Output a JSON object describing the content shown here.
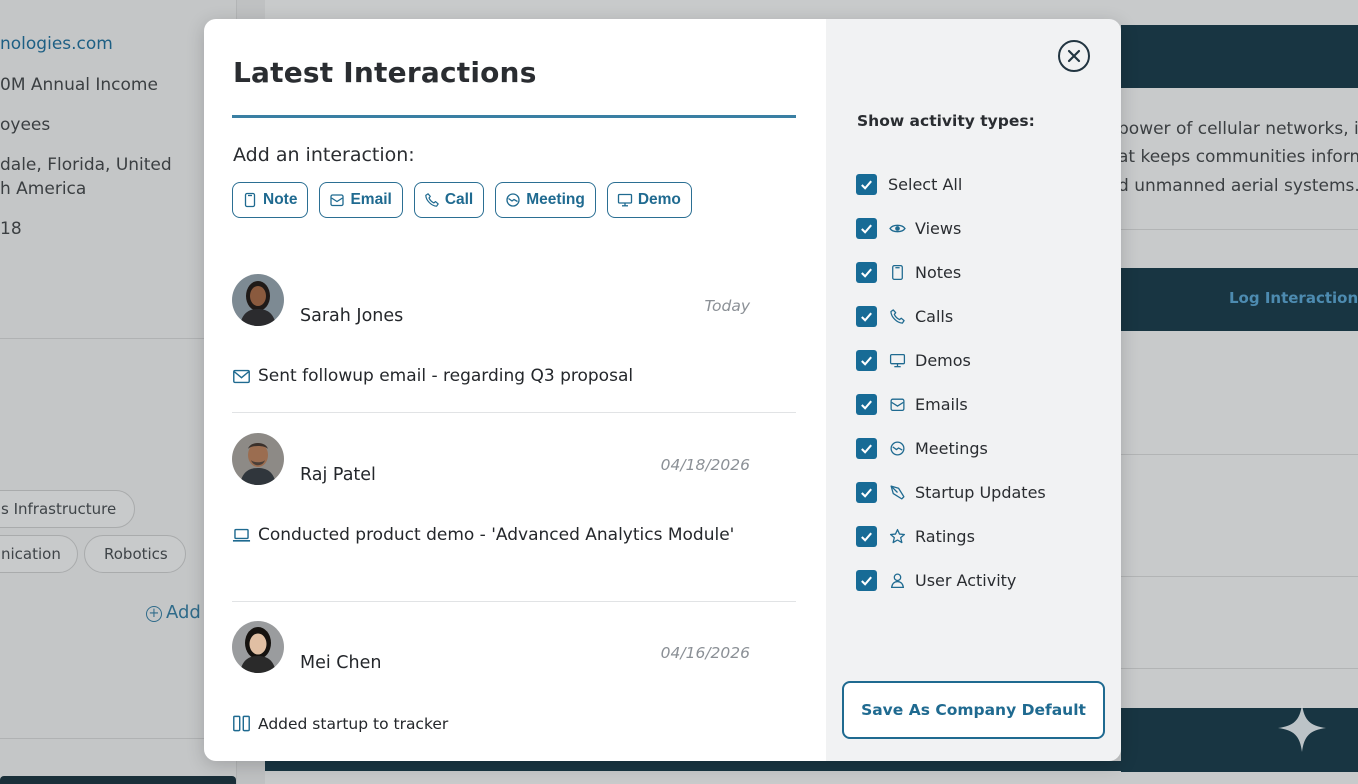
{
  "background": {
    "left_lines": [
      "nologies.com",
      "0M Annual Income",
      "oyees",
      "dale, Florida, United",
      "h America",
      "18"
    ],
    "tags": [
      "s Infrastructure",
      "nication",
      "Robotics"
    ],
    "add_label": "Add",
    "right_lines": [
      "power of cellular networks, i",
      "at keeps communities inform",
      "d unmanned aerial systems."
    ],
    "log_interaction": "Log Interaction"
  },
  "modal": {
    "title": "Latest Interactions",
    "add_label": "Add an interaction:",
    "chips": [
      {
        "label": "Note",
        "icon": "note-icon"
      },
      {
        "label": "Email",
        "icon": "email-icon"
      },
      {
        "label": "Call",
        "icon": "phone-icon"
      },
      {
        "label": "Meeting",
        "icon": "handshake-icon"
      },
      {
        "label": "Demo",
        "icon": "monitor-icon"
      }
    ],
    "entries": [
      {
        "name": "Sarah Jones",
        "date": "Today",
        "icon": "email-icon",
        "description": "Sent followup email - regarding Q3 proposal"
      },
      {
        "name": "Raj Patel",
        "date": "04/18/2026",
        "icon": "laptop-icon",
        "description": "Conducted product demo - 'Advanced Analytics Module'"
      },
      {
        "name": "Mei Chen",
        "date": "04/16/2026",
        "icon": "tracker-icon",
        "description": "Added startup to tracker"
      }
    ],
    "filters": {
      "title": "Show activity types:",
      "select_all": "Select All",
      "items": [
        {
          "label": "Views",
          "icon": "eye-icon",
          "checked": true
        },
        {
          "label": "Notes",
          "icon": "note-icon",
          "checked": true
        },
        {
          "label": "Calls",
          "icon": "phone-icon",
          "checked": true
        },
        {
          "label": "Demos",
          "icon": "monitor-icon",
          "checked": true
        },
        {
          "label": "Emails",
          "icon": "email-icon",
          "checked": true
        },
        {
          "label": "Meetings",
          "icon": "handshake-icon",
          "checked": true
        },
        {
          "label": "Startup Updates",
          "icon": "rocket-icon",
          "checked": true
        },
        {
          "label": "Ratings",
          "icon": "star-icon",
          "checked": true
        },
        {
          "label": "User Activity",
          "icon": "user-icon",
          "checked": true
        }
      ]
    },
    "save_button": "Save As Company Default",
    "colors": {
      "accent": "#1f6a90",
      "checkbox": "#176b96",
      "title_rule": "#3a7fa3",
      "dark_header": "#183542"
    }
  }
}
